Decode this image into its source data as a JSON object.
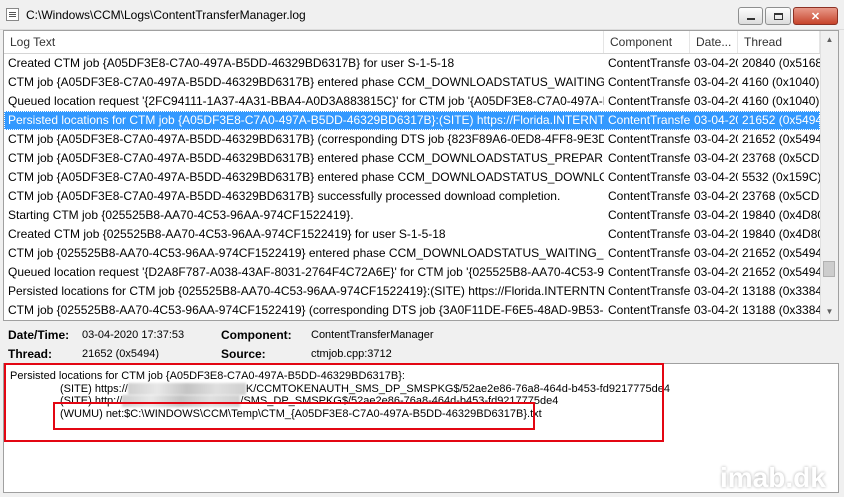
{
  "window": {
    "title": "C:\\Windows\\CCM\\Logs\\ContentTransferManager.log"
  },
  "columns": {
    "log_text": "Log Text",
    "component": "Component",
    "date": "Date...",
    "thread": "Thread"
  },
  "rows": [
    {
      "text": "Created CTM job {A05DF3E8-C7A0-497A-B5DD-46329BD6317B} for user S-1-5-18",
      "component": "ContentTransfe",
      "date": "03-04-20",
      "thread": "20840 (0x5168"
    },
    {
      "text": "CTM job {A05DF3E8-C7A0-497A-B5DD-46329BD6317B} entered phase CCM_DOWNLOADSTATUS_WAITING_CO...",
      "component": "ContentTransfe",
      "date": "03-04-20",
      "thread": "4160 (0x1040)"
    },
    {
      "text": "Queued location request '{2FC94111-1A37-4A31-BBA4-A0D3A883815C}' for CTM job '{A05DF3E8-C7A0-497A-B...",
      "component": "ContentTransfe",
      "date": "03-04-20",
      "thread": "4160 (0x1040)"
    },
    {
      "text": "Persisted locations for CTM job {A05DF3E8-C7A0-497A-B5DD-46329BD6317B}:(SITE) https://Florida.INTERNTNE...",
      "component": "ContentTransfe",
      "date": "03-04-20",
      "thread": "21652 (0x5494",
      "selected": true
    },
    {
      "text": "CTM job {A05DF3E8-C7A0-497A-B5DD-46329BD6317B} (corresponding DTS job {823F89A6-0ED8-4FF8-9E3D-8B...",
      "component": "ContentTransfe",
      "date": "03-04-20",
      "thread": "21652 (0x5494"
    },
    {
      "text": "CTM job {A05DF3E8-C7A0-497A-B5DD-46329BD6317B} entered phase CCM_DOWNLOADSTATUS_PREPARING_D...",
      "component": "ContentTransfe",
      "date": "03-04-20",
      "thread": "23768 (0x5CD8"
    },
    {
      "text": "CTM job {A05DF3E8-C7A0-497A-B5DD-46329BD6317B} entered phase CCM_DOWNLOADSTATUS_DOWNLOADI...",
      "component": "ContentTransfe",
      "date": "03-04-20",
      "thread": "5532 (0x159C)"
    },
    {
      "text": "CTM job {A05DF3E8-C7A0-497A-B5DD-46329BD6317B} successfully processed download completion.",
      "component": "ContentTransfe",
      "date": "03-04-20",
      "thread": "23768 (0x5CD8"
    },
    {
      "text": "Starting CTM job {025525B8-AA70-4C53-96AA-974CF1522419}.",
      "component": "ContentTransfe",
      "date": "03-04-20",
      "thread": "19840 (0x4D80"
    },
    {
      "text": "Created CTM job {025525B8-AA70-4C53-96AA-974CF1522419} for user S-1-5-18",
      "component": "ContentTransfe",
      "date": "03-04-20",
      "thread": "19840 (0x4D80"
    },
    {
      "text": "CTM job {025525B8-AA70-4C53-96AA-974CF1522419} entered phase CCM_DOWNLOADSTATUS_WAITING_CON...",
      "component": "ContentTransfe",
      "date": "03-04-20",
      "thread": "21652 (0x5494"
    },
    {
      "text": "Queued location request '{D2A8F787-A038-43AF-8031-2764F4C72A6E}' for CTM job '{025525B8-AA70-4C53-96....",
      "component": "ContentTransfe",
      "date": "03-04-20",
      "thread": "21652 (0x5494"
    },
    {
      "text": "Persisted locations for CTM job {025525B8-AA70-4C53-96AA-974CF1522419}:(SITE) https://Florida.INTERNTNET...",
      "component": "ContentTransfe",
      "date": "03-04-20",
      "thread": "13188 (0x3384"
    },
    {
      "text": "CTM job {025525B8-AA70-4C53-96AA-974CF1522419} (corresponding DTS job {3A0F11DE-F6E5-48AD-9B53-B57...",
      "component": "ContentTransfe",
      "date": "03-04-20",
      "thread": "13188 (0x3384"
    }
  ],
  "details": {
    "datetime_label": "Date/Time:",
    "datetime_value": "03-04-2020 17:37:53",
    "component_label": "Component:",
    "component_value": "ContentTransferManager",
    "thread_label": "Thread:",
    "thread_value": "21652 (0x5494)",
    "source_label": "Source:",
    "source_value": "ctmjob.cpp:3712"
  },
  "message": {
    "line1": "Persisted locations for CTM job {A05DF3E8-C7A0-497A-B5DD-46329BD6317B}:",
    "line2_prefix": "(SITE) https://",
    "line2_suffix": "K/CCMTOKENAUTH_SMS_DP_SMSPKG$/52ae2e86-76a8-464d-b453-fd9217775de4",
    "line3_prefix": "(SITE) http://",
    "line3_suffix": "/SMS_DP_SMSPKG$/52ae2e86-76a8-464d-b453-fd9217775de4",
    "line4": "(WUMU) net:$C:\\WINDOWS\\CCM\\Temp\\CTM_{A05DF3E8-C7A0-497A-B5DD-46329BD6317B}.txt"
  },
  "watermark": "imab.dk",
  "colors": {
    "selection": "#3399ff",
    "highlight_box": "#e30613"
  }
}
